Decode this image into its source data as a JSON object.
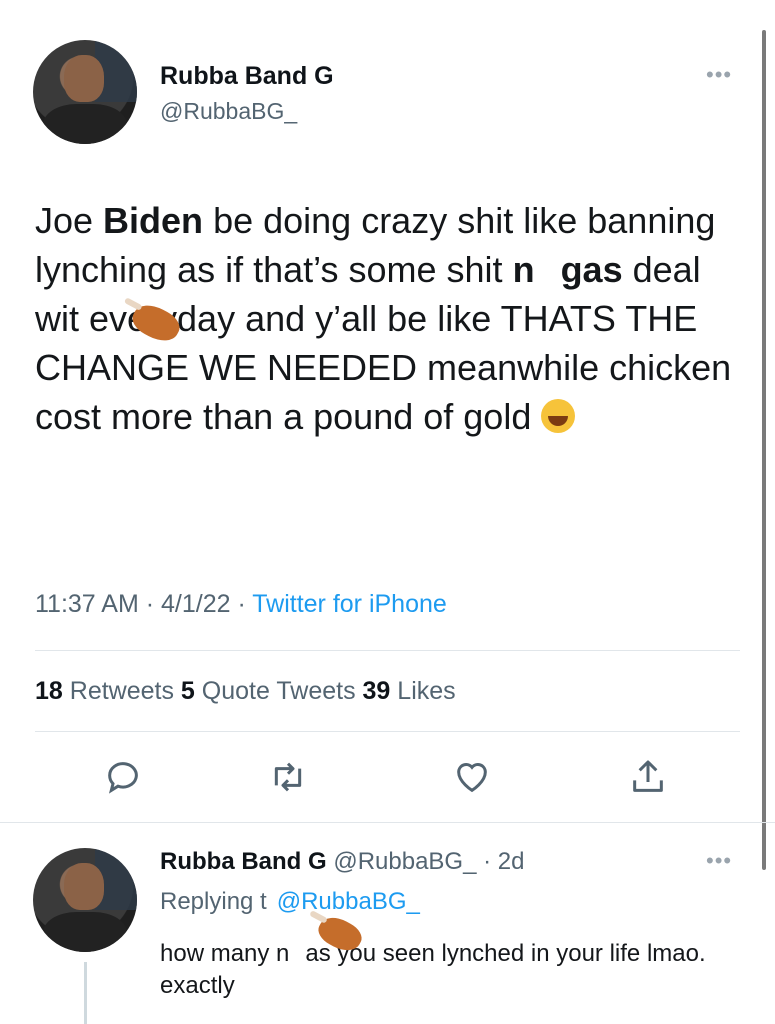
{
  "tweet": {
    "author_name": "Rubba Band G",
    "author_handle": "@RubbaBG_",
    "text_parts": {
      "p1": "Joe ",
      "p1_bold": "Biden",
      "p2": " be doing crazy shit like banning lynching as if that’s some shit ",
      "p2_bold_a": "n",
      "p2_bold_b": "gas",
      "p3": " deal wit everyday and y’all be like THATS THE CHANGE WE NEEDED meanwhile chicken cost more than a pound of gold "
    },
    "emoji_laugh": "laughing-tears-emoji",
    "time": "11:37 AM · 4/1/22 · ",
    "source": "Twitter for iPhone",
    "retweets_count": "18",
    "retweets_label": " Retweets ",
    "quotes_count": "5",
    "quotes_label": " Quote Tweets ",
    "likes_count": "39",
    "likes_label": " Likes",
    "icons": [
      "reply-icon",
      "retweet-icon",
      "like-icon",
      "share-icon"
    ]
  },
  "reply": {
    "author_name": "Rubba Band G",
    "handle_and_time": " @RubbaBG_ · 2d",
    "replying_prefix": "Replying t",
    "replying_mention": "@RubbaBG_",
    "text_a": "how many n",
    "text_b": "as you seen lynched in your life lmao. exactly"
  },
  "more_glyph": "•••",
  "colors": {
    "accent": "#1d9bf0",
    "secondary_text": "#536471",
    "primary_text": "#0f1419",
    "divider": "#e1e6ea"
  }
}
